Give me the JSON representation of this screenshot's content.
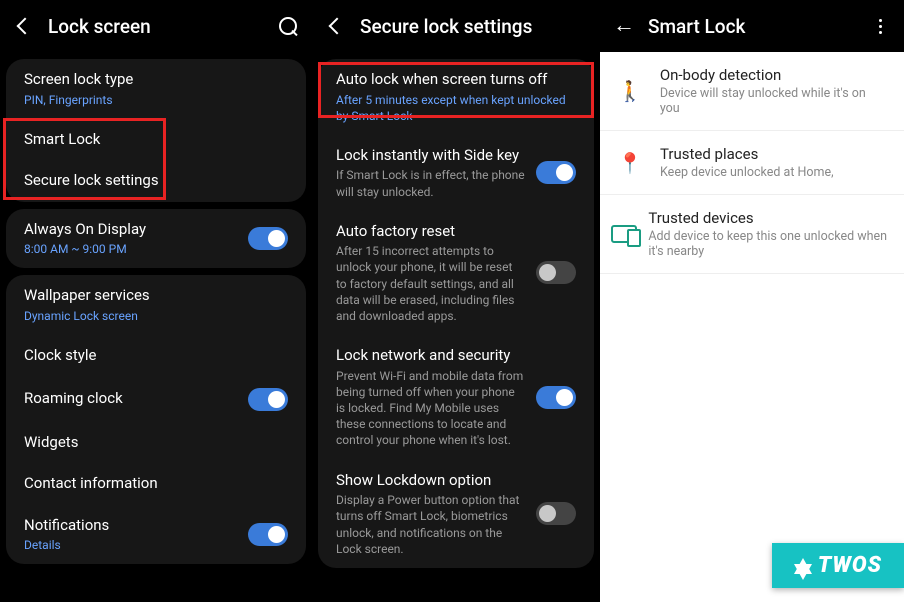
{
  "panel1": {
    "header": {
      "title": "Lock screen"
    },
    "g1": {
      "screen_lock_type": {
        "title": "Screen lock type",
        "sub": "PIN, Fingerprints"
      },
      "smart_lock": {
        "title": "Smart Lock"
      },
      "secure_lock": {
        "title": "Secure lock settings"
      }
    },
    "g2": {
      "aod": {
        "title": "Always On Display",
        "sub": "8:00 AM ~ 9:00 PM"
      }
    },
    "g3": {
      "wallpaper": {
        "title": "Wallpaper services",
        "sub": "Dynamic Lock screen"
      },
      "clock_style": {
        "title": "Clock style"
      },
      "roaming_clock": {
        "title": "Roaming clock"
      },
      "widgets": {
        "title": "Widgets"
      },
      "contact_info": {
        "title": "Contact information"
      },
      "notifications": {
        "title": "Notifications",
        "sub": "Details"
      }
    }
  },
  "panel2": {
    "header": {
      "title": "Secure lock settings"
    },
    "auto_lock": {
      "title": "Auto lock when screen turns off",
      "sub": "After 5 minutes except when kept unlocked by Smart Lock"
    },
    "lock_side_key": {
      "title": "Lock instantly with Side key",
      "sub": "If Smart Lock is in effect, the phone will stay unlocked."
    },
    "auto_factory_reset": {
      "title": "Auto factory reset",
      "sub": "After 15 incorrect attempts to unlock your phone, it will be reset to factory default settings, and all data will be erased, including files and downloaded apps."
    },
    "lock_network": {
      "title": "Lock network and security",
      "sub": "Prevent Wi-Fi and mobile data from being turned off when your phone is locked. Find My Mobile uses these connections to locate and control your phone when it's lost."
    },
    "show_lockdown": {
      "title": "Show Lockdown option",
      "sub": "Display a Power button option that turns off Smart Lock, biometrics unlock, and notifications on the Lock screen."
    }
  },
  "panel3": {
    "header": {
      "title": "Smart Lock"
    },
    "on_body": {
      "title": "On-body detection",
      "sub": "Device will stay unlocked while it's on you"
    },
    "trusted_places": {
      "title": "Trusted places",
      "sub": "Keep device unlocked at Home,"
    },
    "trusted_devices": {
      "title": "Trusted devices",
      "sub": "Add device to keep this one unlocked when it's nearby"
    }
  },
  "watermark": "TWOS"
}
